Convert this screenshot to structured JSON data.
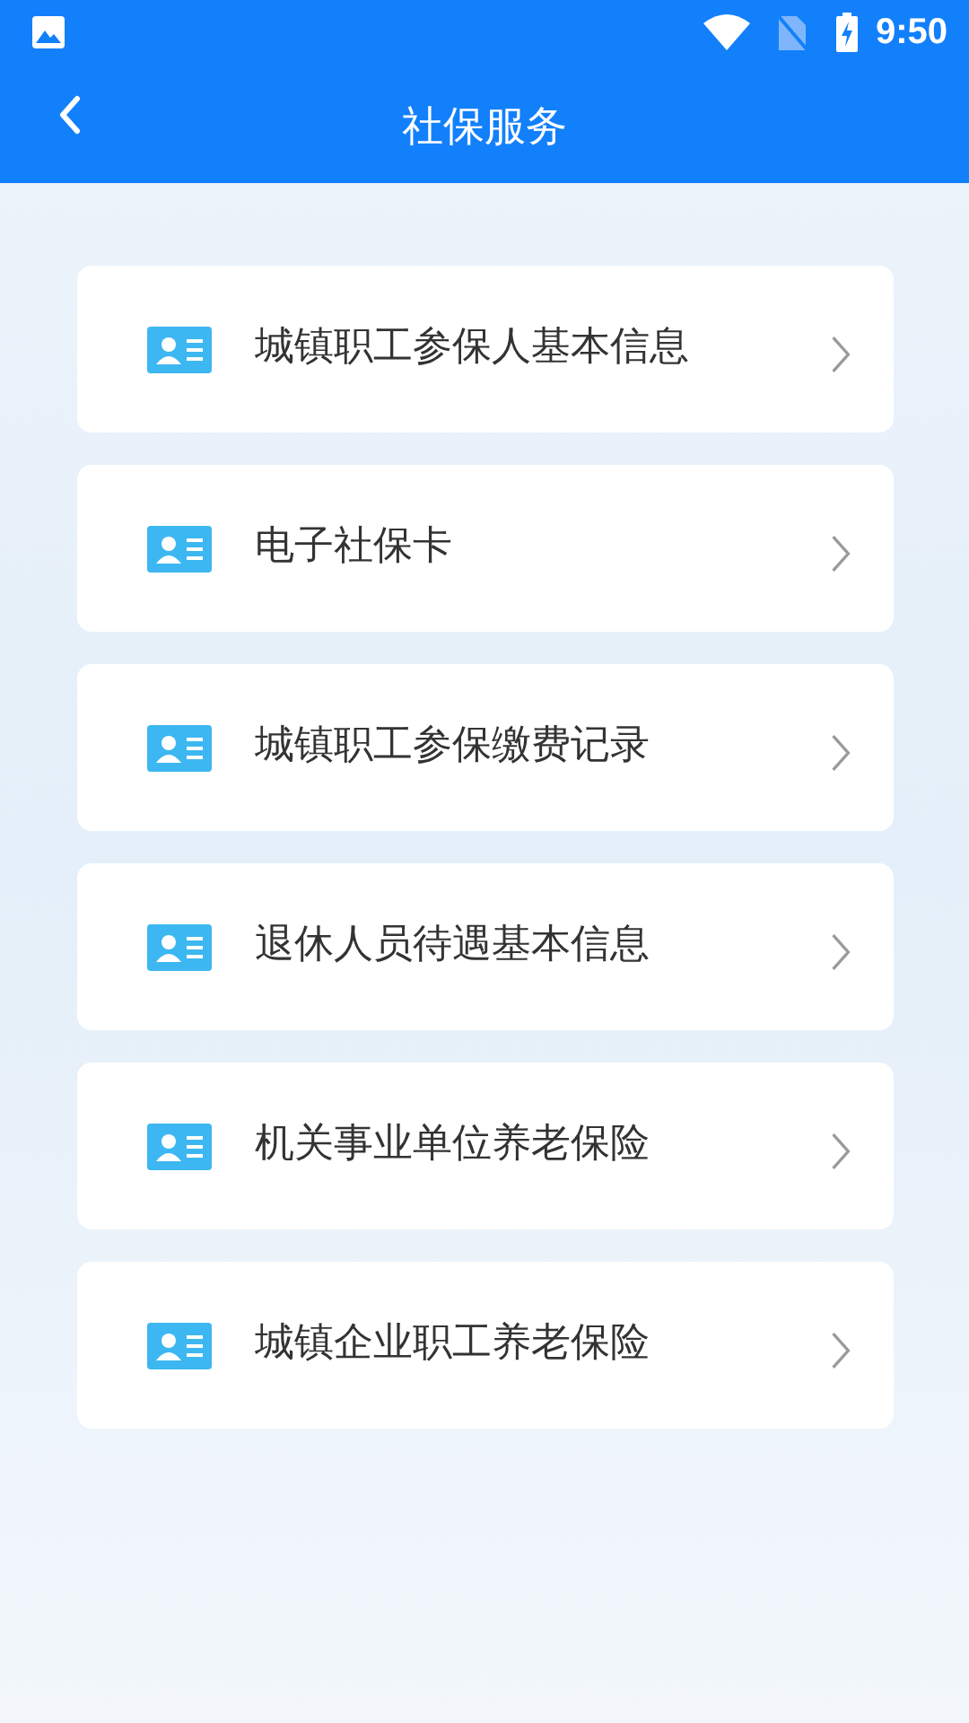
{
  "status_bar": {
    "time": "9:50"
  },
  "header": {
    "title": "社保服务"
  },
  "items": [
    {
      "label": "城镇职工参保人基本信息"
    },
    {
      "label": "电子社保卡"
    },
    {
      "label": "城镇职工参保缴费记录"
    },
    {
      "label": "退休人员待遇基本信息"
    },
    {
      "label": "机关事业单位养老保险"
    },
    {
      "label": "城镇企业职工养老保险"
    }
  ]
}
